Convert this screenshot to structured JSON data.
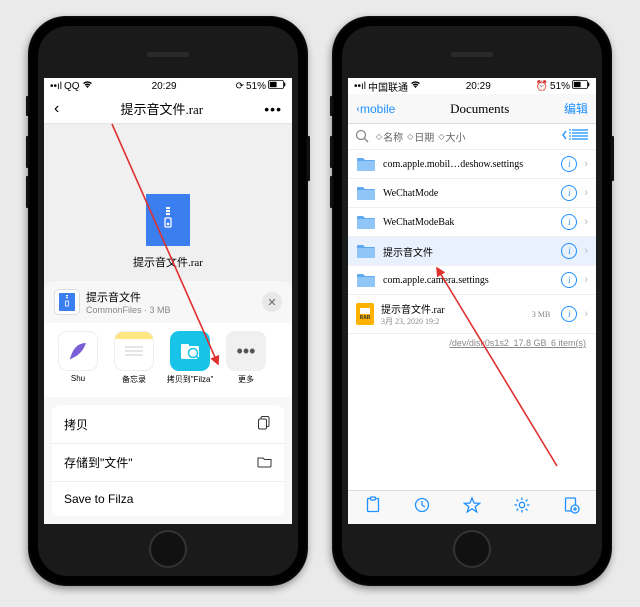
{
  "phone1": {
    "status": {
      "carrier": "QQ",
      "time": "20:29",
      "battery": "51%"
    },
    "nav": {
      "title": "提示音文件.rar"
    },
    "file_display": "提示音文件.rar",
    "share": {
      "file_title": "提示音文件",
      "file_sub": "CommonFiles · 3 MB",
      "apps": [
        {
          "label": "Shu"
        },
        {
          "label": "备忘录"
        },
        {
          "label": "拷贝到\"Filza\""
        },
        {
          "label": "更多"
        }
      ],
      "actions": [
        {
          "label": "拷贝"
        },
        {
          "label": "存储到\"文件\""
        },
        {
          "label": "Save to Filza"
        }
      ]
    }
  },
  "phone2": {
    "status": {
      "carrier": "中国联通",
      "time": "20:29",
      "battery": "51%"
    },
    "nav": {
      "back": "mobile",
      "title": "Documents",
      "edit": "编辑"
    },
    "sort": {
      "opt1": "名称",
      "opt2": "日期",
      "opt3": "大小"
    },
    "files": [
      {
        "name": "com.apple.mobil…deshow.settings",
        "type": "folder",
        "highlighted": false
      },
      {
        "name": "WeChatMode",
        "type": "folder",
        "highlighted": false
      },
      {
        "name": "WeChatModeBak",
        "type": "folder",
        "highlighted": false
      },
      {
        "name": "提示音文件",
        "type": "folder",
        "highlighted": true
      },
      {
        "name": "com.apple.camera.settings",
        "type": "folder",
        "highlighted": false
      },
      {
        "name": "提示音文件.rar",
        "type": "rar",
        "meta": "3月 23, 2020 19:2",
        "size": "3 MB",
        "highlighted": false
      }
    ],
    "disk": {
      "path": "/dev/disk0s1s2",
      "free": "17.8 GB",
      "items": "6 item(s)"
    }
  }
}
